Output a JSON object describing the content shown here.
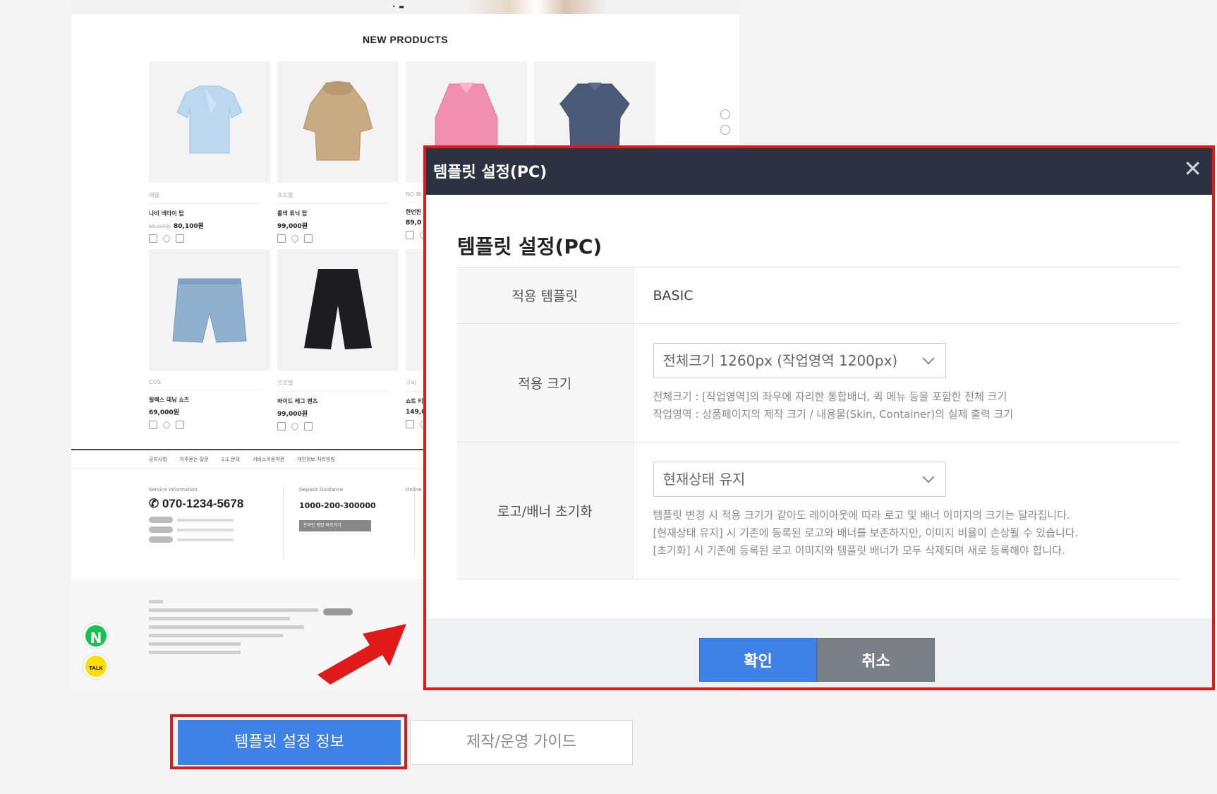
{
  "shop": {
    "section_title": "NEW PRODUCTS",
    "products": [
      {
        "brand": "애월",
        "name": "나비 넥타이 탑",
        "old_price": "85,000원",
        "price": "80,100원",
        "color": "#bcd8ef"
      },
      {
        "brand": "프로엘",
        "name": "롤넥 튜닉 탑",
        "old_price": "",
        "price": "99,000원",
        "color": "#c8ab82"
      },
      {
        "brand": "NO BI",
        "name": "한언한",
        "old_price": "",
        "price": "89,0",
        "color": "#f08fb0"
      },
      {
        "brand": "",
        "name": "",
        "old_price": "",
        "price": "",
        "color": "#4b5a78"
      },
      {
        "brand": "COS",
        "name": "릴렉스 데님 쇼츠",
        "old_price": "",
        "price": "69,000원",
        "color": "#8fb0cf"
      },
      {
        "brand": "프로엘",
        "name": "와이드 레그 팬츠",
        "old_price": "",
        "price": "99,000원",
        "color": "#1d1d1f"
      },
      {
        "brand": "구씨",
        "name": "쇼트 티",
        "old_price": "",
        "price": "149,0",
        "color": "#dddddd"
      }
    ],
    "footer_links": [
      "공지사항",
      "자주묻는 질문",
      "1:1 문의",
      "서비스이용약관",
      "개인정보 처리방침"
    ],
    "service": {
      "caption": "Service Information",
      "phone": "070-1234-5678"
    },
    "deposit": {
      "caption": "Deposit Guidance",
      "account": "1000-200-300000",
      "button": "온라인 뱅킹 바로가기"
    },
    "online": {
      "caption": "Online"
    },
    "float_n": "N",
    "float_talk": "TALK"
  },
  "tabs": {
    "primary": "템플릿 설정 정보",
    "secondary": "제작/운영 가이드"
  },
  "modal": {
    "header_title": "템플릿 설정(PC)",
    "close": "✕",
    "title": "템플릿 설정(PC)",
    "rows": {
      "template": {
        "label": "적용 템플릿",
        "value": "BASIC"
      },
      "size": {
        "label": "적용 크기",
        "selected": "전체크기 1260px (작업영역 1200px)",
        "desc1": "전체크기 : [작업영역]의 좌우에 자리한 통합배너, 퀵 메뉴 등을 포함한 전체 크기",
        "desc2": "작업영역 : 상품페이지의 제작 크기 / 내용물(Skin, Container)의 실제 출력 크기"
      },
      "reset": {
        "label": "로고/배너 초기화",
        "selected": "현재상태 유지",
        "desc1": "템플릿 변경 시 적용 크기가 같아도 레이아웃에 따라 로고 및 배너 이미지의 크기는 달라집니다.",
        "desc2": "[현재상태 유지] 시 기존에 등록된 로고와 배너를 보존하지만, 이미지 비율이 손상될 수 있습니다.",
        "desc3": "[초기화] 시 기존에 등록된 로고 이미지와 템플릿 배너가 모두 삭제되며 새로 등록해야 합니다."
      }
    },
    "confirm": "확인",
    "cancel": "취소"
  },
  "colors": {
    "primary_blue": "#3f82e7",
    "highlight_red": "#e01919",
    "modal_header": "#2b3342",
    "cancel_gray": "#7a8088"
  }
}
